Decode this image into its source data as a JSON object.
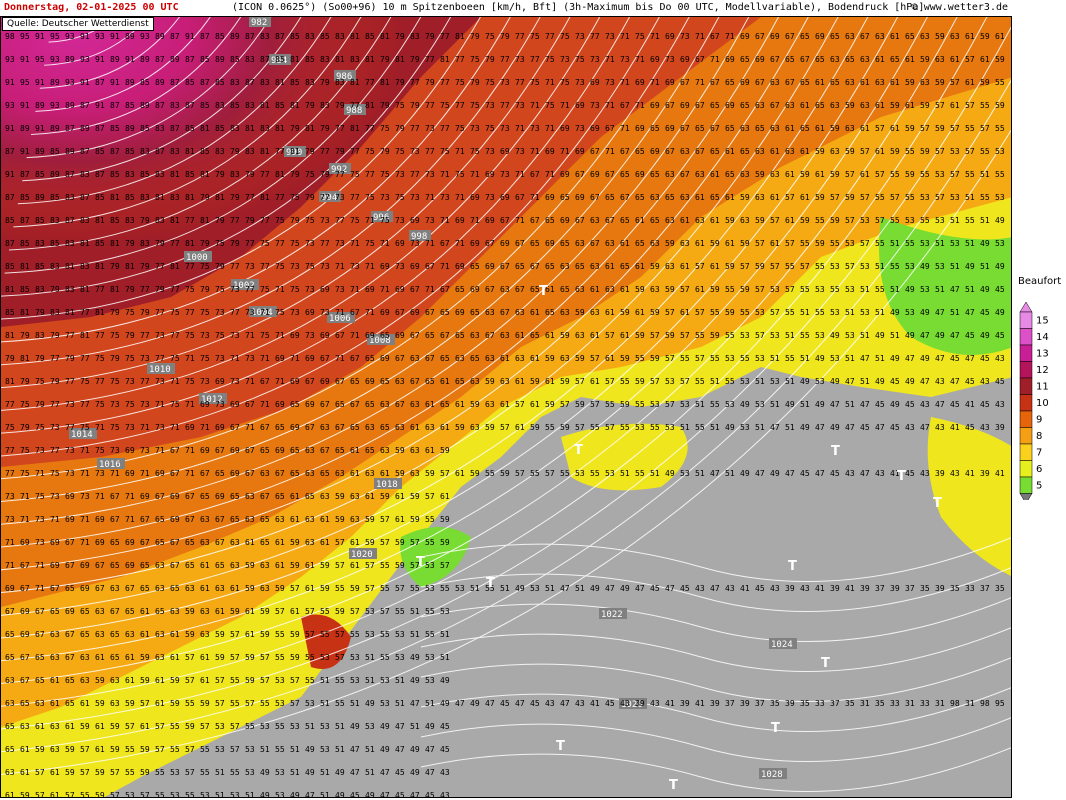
{
  "header": {
    "date": "Donnerstag, 02-01-2025   00 UTC",
    "model": "(ICON 0.0625°) (So00+96)  10 m Spitzenboeen [km/h, Bft] (3h-Maximum bis Do 00 UTC, Modellvariable), Bodendruck [hPa]",
    "site": "© www.wetter3.de"
  },
  "source": "Quelle: Deutscher Wetterdienst",
  "legend": {
    "title": "Beaufort",
    "levels": [
      {
        "value": "15",
        "color": "#e68ae6"
      },
      {
        "value": "14",
        "color": "#dc50c8"
      },
      {
        "value": "13",
        "color": "#c81e96"
      },
      {
        "value": "12",
        "color": "#b4145a"
      },
      {
        "value": "11",
        "color": "#a01e28"
      },
      {
        "value": "10",
        "color": "#c83214"
      },
      {
        "value": "9",
        "color": "#e6640a"
      },
      {
        "value": "8",
        "color": "#f5a014"
      },
      {
        "value": "7",
        "color": "#fad21e"
      },
      {
        "value": "6",
        "color": "#e6f01e"
      },
      {
        "value": "5",
        "color": "#78dc32"
      }
    ],
    "below_color": "#787878"
  },
  "map": {
    "colors": {
      "land_gray": "#a9a9a9",
      "storm_magenta": "#c81e78",
      "deep_red": "#a01e28",
      "orange_red": "#d2461e",
      "orange": "#e6780f",
      "yellow_orange": "#f5aa14",
      "yellow": "#f0e61e",
      "green": "#78dc32"
    },
    "isobar_labels": [
      "982",
      "984",
      "986",
      "988",
      "990",
      "992",
      "994",
      "996",
      "998",
      "1000",
      "1002",
      "1004",
      "1006",
      "1008",
      "1010",
      "1012",
      "1014",
      "1016",
      "1018",
      "1020",
      "1022",
      "1024",
      "1026",
      "1028"
    ],
    "low_marker": "T",
    "sample_gust_values": [
      "98",
      "95",
      "93",
      "91",
      "89",
      "87",
      "85",
      "83",
      "81",
      "79",
      "77",
      "75",
      "73",
      "71",
      "69",
      "67",
      "65",
      "63",
      "61",
      "59",
      "57",
      "55",
      "53",
      "51",
      "49",
      "47",
      "45",
      "43",
      "41",
      "39",
      "37",
      "35",
      "33",
      "31"
    ]
  }
}
